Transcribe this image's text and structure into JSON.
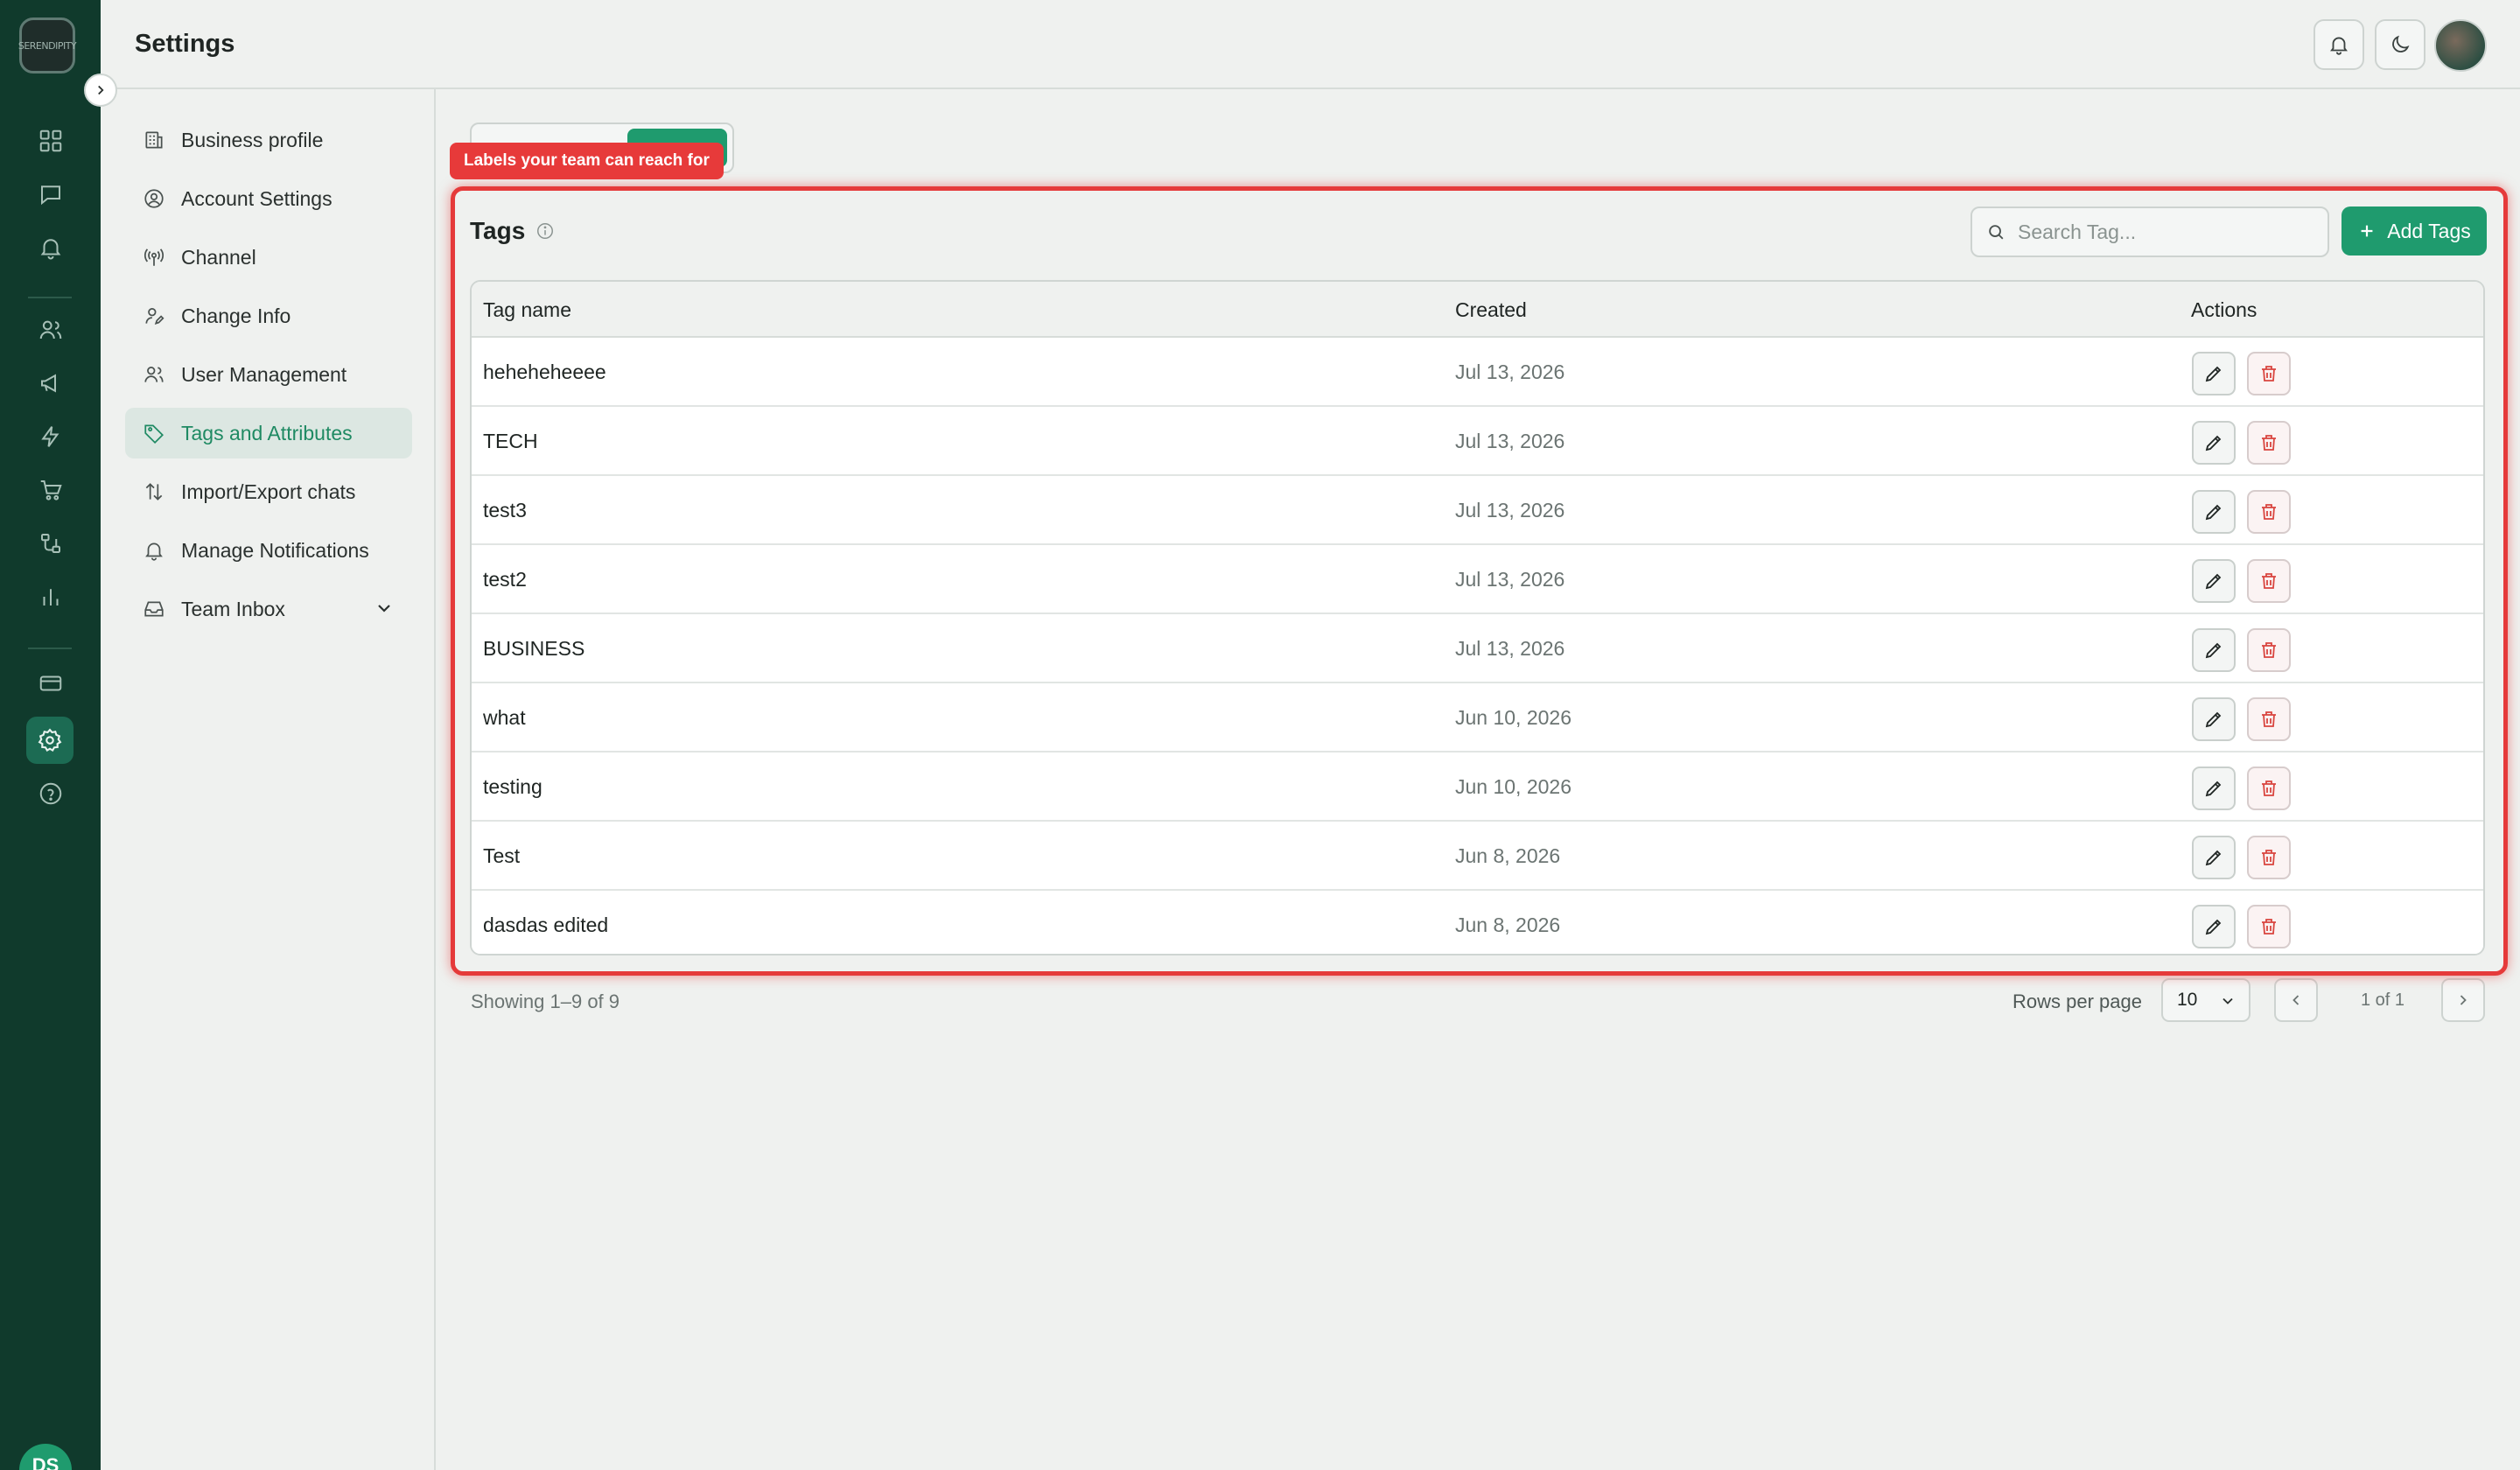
{
  "rail": {
    "logo_text": "SERENDIPITY",
    "avatar_initials": "DS",
    "icons": [
      "dashboard-icon",
      "chat-icon",
      "bell-icon",
      "contacts-icon",
      "megaphone-icon",
      "bolt-icon",
      "cart-icon",
      "flow-icon",
      "analytics-icon",
      "billing-icon",
      "settings-icon",
      "help-icon"
    ],
    "active_icon": "settings-icon"
  },
  "header": {
    "title": "Settings"
  },
  "subnav": {
    "items": [
      {
        "label": "Business profile",
        "icon": "building-icon"
      },
      {
        "label": "Account Settings",
        "icon": "user-circle-icon"
      },
      {
        "label": "Channel",
        "icon": "broadcast-icon"
      },
      {
        "label": "Change Info",
        "icon": "user-edit-icon"
      },
      {
        "label": "User Management",
        "icon": "users-icon"
      },
      {
        "label": "Tags and Attributes",
        "icon": "tag-icon",
        "active": true
      },
      {
        "label": "Import/Export chats",
        "icon": "arrows-updown-icon"
      },
      {
        "label": "Manage Notifications",
        "icon": "bell-icon"
      },
      {
        "label": "Team Inbox",
        "icon": "inbox-icon",
        "expandable": true
      }
    ]
  },
  "tooltip": {
    "text": "Labels your team can reach for"
  },
  "tags": {
    "title": "Tags",
    "search_placeholder": "Search Tag...",
    "add_label": "Add Tags",
    "columns": {
      "name": "Tag name",
      "created": "Created",
      "actions": "Actions"
    },
    "rows": [
      {
        "name": "heheheheeee",
        "created": "Jul 13, 2026"
      },
      {
        "name": "TECH",
        "created": "Jul 13, 2026"
      },
      {
        "name": "test3",
        "created": "Jul 13, 2026"
      },
      {
        "name": "test2",
        "created": "Jul 13, 2026"
      },
      {
        "name": "BUSINESS",
        "created": "Jul 13, 2026"
      },
      {
        "name": "what",
        "created": "Jun 10, 2026"
      },
      {
        "name": "testing",
        "created": "Jun 10, 2026"
      },
      {
        "name": "Test",
        "created": "Jun 8, 2026"
      },
      {
        "name": "dasdas edited",
        "created": "Jun 8, 2026"
      }
    ]
  },
  "pagination": {
    "showing": "Showing 1–9 of 9",
    "rows_label": "Rows per page",
    "rows_value": "10",
    "page_text": "1 of 1"
  },
  "colors": {
    "accent": "#1f9b6e",
    "rail": "#103a2c",
    "highlight": "#e53a3a",
    "danger": "#d9453f"
  }
}
